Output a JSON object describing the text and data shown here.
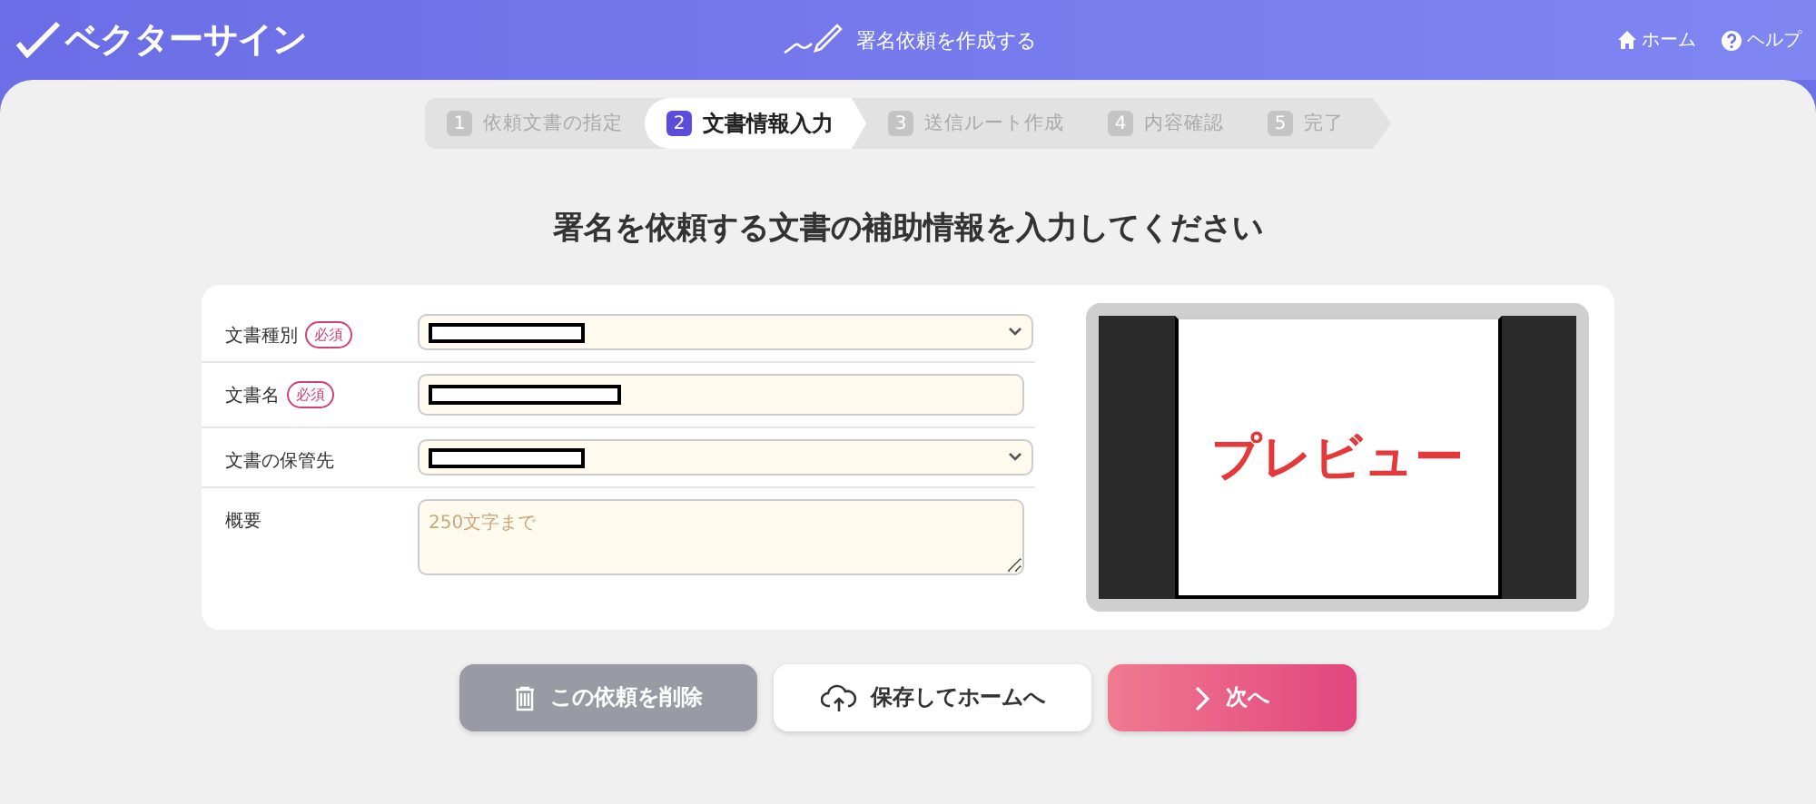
{
  "header": {
    "logo": "ベクターサイン",
    "page_title": "署名依頼を作成する",
    "links": [
      {
        "kind": "home",
        "label": "ホーム"
      },
      {
        "kind": "help",
        "label": "ヘルプ"
      }
    ]
  },
  "steps": [
    {
      "number": "1",
      "label": "依頼文書の指定",
      "selected": false
    },
    {
      "number": "2",
      "label": "文書情報入力",
      "selected": true
    },
    {
      "number": "3",
      "label": "送信ルート作成",
      "selected": false
    },
    {
      "number": "4",
      "label": "内容確認",
      "selected": false
    },
    {
      "number": "5",
      "label": "完了",
      "selected": false
    }
  ],
  "heading": "署名を依頼する文書の補助情報を入力してください",
  "form": [
    {
      "kind": "select",
      "label": "文書種別",
      "required": true,
      "badge": "必須"
    },
    {
      "kind": "text",
      "label": "文書名",
      "required": true,
      "badge": "必須"
    },
    {
      "kind": "select",
      "label": "文書の保管先",
      "required": false
    },
    {
      "kind": "textarea",
      "label": "概要",
      "required": false,
      "placeholder": "250文字まで"
    }
  ],
  "preview": {
    "label": "プレビュー"
  },
  "buttons": [
    {
      "kind": "delete",
      "label": "この依頼を削除"
    },
    {
      "kind": "save",
      "label": "保存してホームへ"
    },
    {
      "kind": "next",
      "label": "次へ"
    }
  ]
}
